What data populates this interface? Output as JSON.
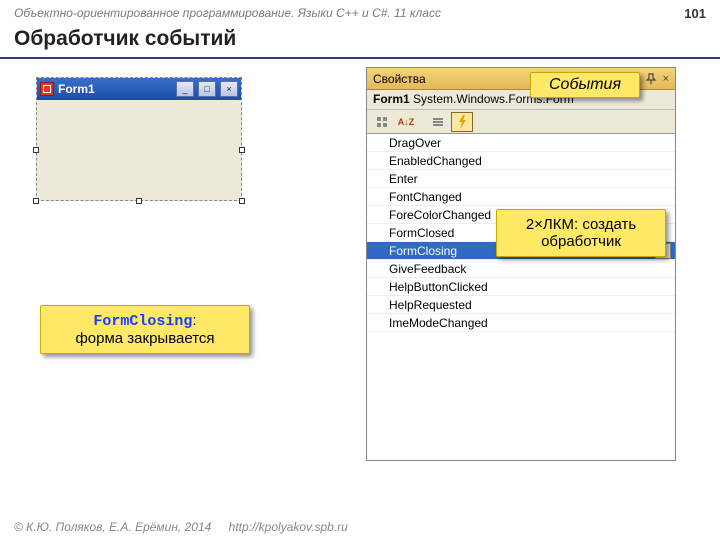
{
  "header": {
    "course": "Объектно-ориентированное программирование. Языки C++ и C#. 11 класс",
    "page": "101"
  },
  "title": "Обработчик событий",
  "form": {
    "title": "Form1"
  },
  "props": {
    "panel_title": "Свойства",
    "object_name": "Form1",
    "object_type": "System.Windows.Forms.Form",
    "sort_label": "A↓Z",
    "events": [
      "DragOver",
      "EnabledChanged",
      "Enter",
      "FontChanged",
      "ForeColorChanged",
      "FormClosed",
      "FormClosing",
      "GiveFeedback",
      "HelpButtonClicked",
      "HelpRequested",
      "ImeModeChanged"
    ],
    "selected_index": 6
  },
  "callouts": {
    "events_label": "События",
    "dblclick": "2×ЛКМ: создать обработчик",
    "formclosing_kw": "FormClosing",
    "formclosing_colon": ":",
    "formclosing_text": "форма закрывается"
  },
  "footer": {
    "copyright": "© К.Ю. Поляков, Е.А. Ерёмин, 2014",
    "url": "http://kpolyakov.spb.ru"
  }
}
